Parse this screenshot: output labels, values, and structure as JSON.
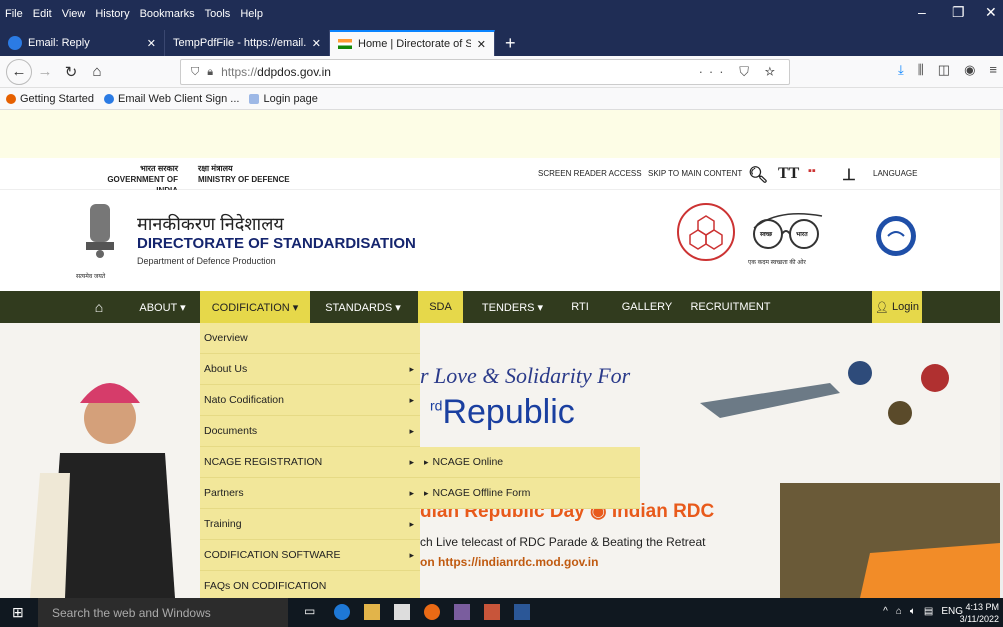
{
  "browser": {
    "menu": [
      "File",
      "Edit",
      "View",
      "History",
      "Bookmarks",
      "Tools",
      "Help"
    ],
    "tabs": [
      {
        "title": "Email: Reply"
      },
      {
        "title": "TempPdfFile - https://email.gov.in/"
      },
      {
        "title": "Home | Directorate of Standard"
      }
    ],
    "url_prefix": "https://",
    "url_host": "ddpdos.gov.in",
    "url_menu": "···",
    "bookmarks": [
      "Getting Started",
      "Email Web Client Sign ...",
      "Login page"
    ]
  },
  "gov_bar": {
    "gov_hi": "भारत सरकार",
    "gov_en": "GOVERNMENT OF INDIA",
    "min_hi": "रक्षा मंत्रालय",
    "min_en": "MINISTRY OF DEFENCE",
    "screen_reader": "SCREEN READER ACCESS",
    "skip": "SKIP TO MAIN CONTENT",
    "language": "LANGUAGE",
    "text_size_icon": "TT"
  },
  "header": {
    "title_hi": "मानकीकरण निदेशालय",
    "title_en": "DIRECTORATE OF STANDARDISATION",
    "dept": "Department of Defence Production",
    "emblem_motto": "सत्यमेव जयते",
    "swachh_1": "स्वच्छ",
    "swachh_2": "भारत",
    "swachh_caption": "एक कदम स्वच्छता की ओर"
  },
  "nav": {
    "about": "ABOUT ▾",
    "codification": "CODIFICATION ▾",
    "standards": "STANDARDS ▾",
    "sda": "SDA",
    "tenders": "TENDERS ▾",
    "rti": "RTI",
    "gallery": "GALLERY",
    "recruitment": "RECRUITMENT",
    "login": "Login"
  },
  "dropdown": [
    {
      "label": "Overview",
      "caret": false
    },
    {
      "label": "About Us",
      "caret": true
    },
    {
      "label": "Nato Codification",
      "caret": true
    },
    {
      "label": "Documents",
      "caret": true
    },
    {
      "label": "NCAGE REGISTRATION",
      "caret": true
    },
    {
      "label": "Partners",
      "caret": true
    },
    {
      "label": "Training",
      "caret": true
    },
    {
      "label": "CODIFICATION SOFTWARE",
      "caret": true
    },
    {
      "label": "FAQs ON CODIFICATION",
      "caret": false
    }
  ],
  "submenu": [
    "NCAGE Online",
    "NCAGE Offline Form"
  ],
  "hero": {
    "line1": "r Love & Solidarity For",
    "line2": "Republic",
    "rd": "rd",
    "line3": "dian Republic Day",
    "line3b": "Indian RDC",
    "line4": "ch Live telecast of RDC Parade & Beating the Retreat",
    "line5": "on https://indianrdc.mod.gov.in"
  },
  "taskbar": {
    "search": "Search the web and Windows",
    "lang": "ENG",
    "time": "4:13 PM",
    "date": "3/11/2022"
  }
}
